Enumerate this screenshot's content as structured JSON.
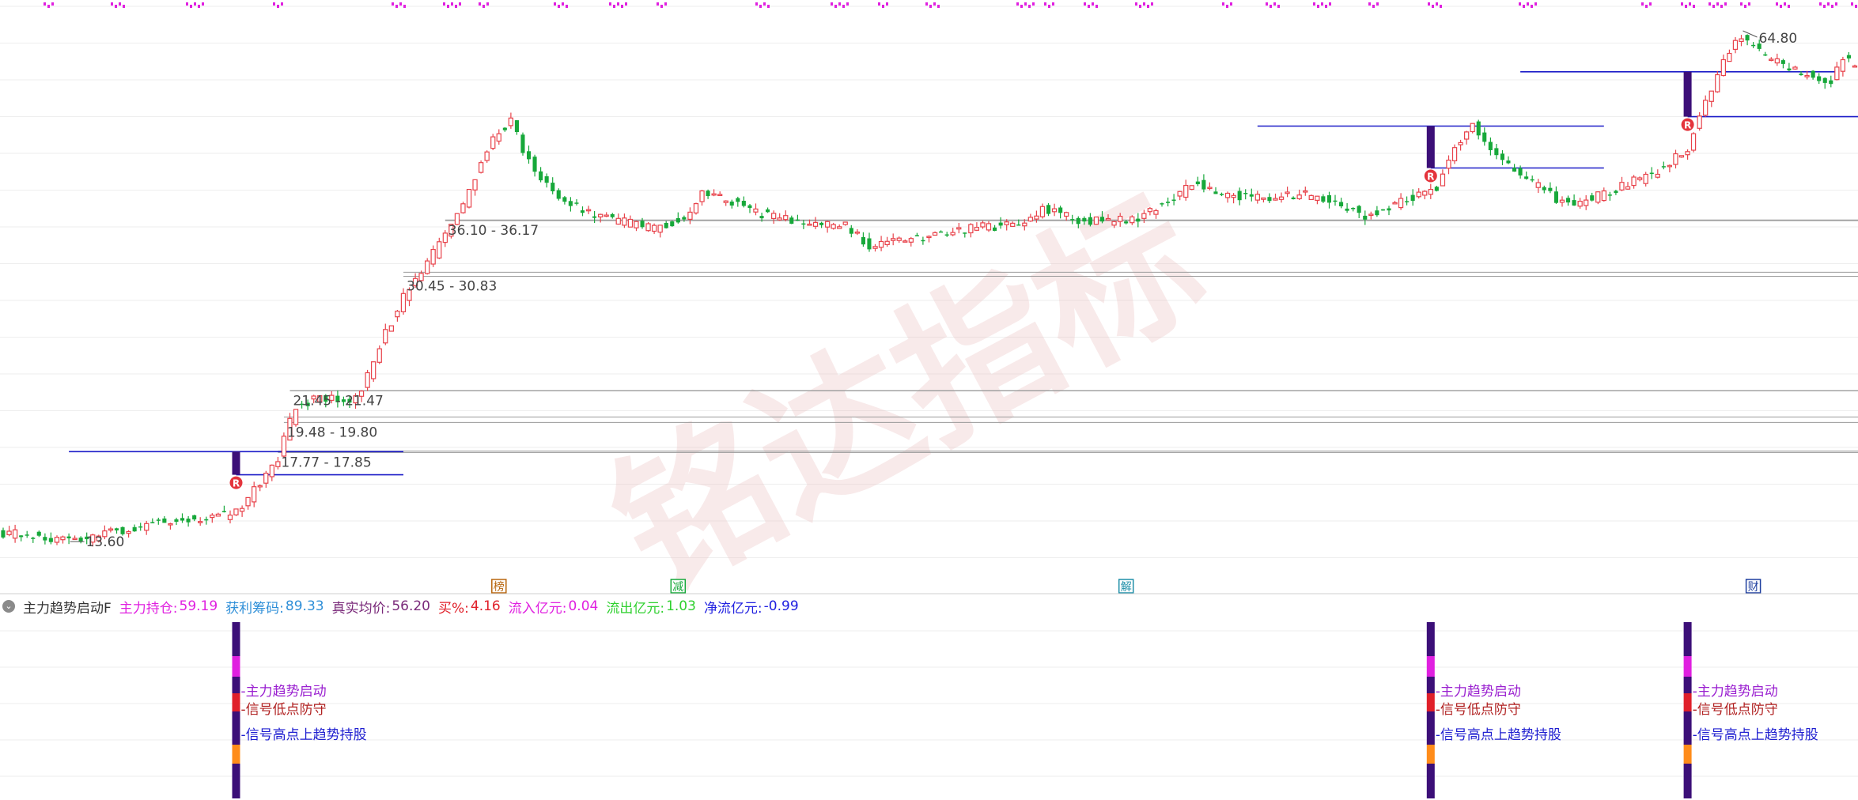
{
  "indicator_bar": {
    "name": "主力趋势启动F",
    "fields": [
      {
        "label": "主力持仓:",
        "value": "59.19",
        "color": "#e020e0"
      },
      {
        "label": "获利筹码:",
        "value": "89.33",
        "color": "#2f8fd8"
      },
      {
        "label": "真实均价:",
        "value": "56.20",
        "color": "#7a2a7a"
      },
      {
        "label": "买%:",
        "value": "4.16",
        "color": "#e0202a"
      },
      {
        "label": "流入亿元:",
        "value": "0.04",
        "color": "#e020e0"
      },
      {
        "label": "流出亿元:",
        "value": "1.03",
        "color": "#2fd02f"
      },
      {
        "label": "净流亿元:",
        "value": "-0.99",
        "color": "#2020e0"
      }
    ]
  },
  "watermark": "铭达指标",
  "colors": {
    "up": "#e8434b",
    "down": "#17a83a",
    "signal_bar": "#3c0f78",
    "support_line": "#1c1cc8",
    "zone_line": "#9a9a9a",
    "label_text": "#444444",
    "magenta": "#e020e0",
    "red": "#e0202a",
    "orange": "#ff8c1a",
    "blue_label": "#1f1fd0",
    "red_label": "#b02020",
    "purple_label": "#9a20d0"
  },
  "chart_data": {
    "type": "candlestick",
    "y_axis": {
      "scale": "log",
      "ylim": [
        12.5,
        68.5
      ]
    },
    "x_axis": {
      "bar_count": 311
    },
    "price_labels": [
      {
        "text": "64.80",
        "price": 64.8,
        "bar": 291,
        "kind": "high"
      },
      {
        "text": "13.60",
        "price": 13.6,
        "bar": 12,
        "kind": "low"
      }
    ],
    "price_zones": [
      {
        "text": "36.10 - 36.17",
        "low": 36.1,
        "high": 36.17,
        "start_bar": 74
      },
      {
        "text": "30.45 - 30.83",
        "low": 30.45,
        "high": 30.83,
        "start_bar": 67
      },
      {
        "text": "21.45 - 21.47",
        "low": 21.45,
        "high": 21.47,
        "start_bar": 48
      },
      {
        "text": "19.48 - 19.80",
        "low": 19.48,
        "high": 19.8,
        "start_bar": 47
      },
      {
        "text": "17.77 - 17.85",
        "low": 17.77,
        "high": 17.85,
        "start_bar": 46
      }
    ],
    "signal_segments": [
      {
        "start_bar": 11,
        "end_bar": 67,
        "price": 17.82
      },
      {
        "start_bar": 39,
        "end_bar": 67,
        "price": 16.6
      },
      {
        "start_bar": 210,
        "end_bar": 268,
        "price": 48.2
      },
      {
        "start_bar": 239,
        "end_bar": 268,
        "price": 42.4
      },
      {
        "start_bar": 254,
        "end_bar": 307,
        "price": 56.9
      },
      {
        "start_bar": 282,
        "end_bar": 311,
        "price": 49.6
      }
    ],
    "signal_bars": [
      {
        "bar": 39,
        "top": 17.82,
        "bottom": 16.6,
        "marker": "R"
      },
      {
        "bar": 239,
        "top": 48.2,
        "bottom": 42.4,
        "marker": "R"
      },
      {
        "bar": 282,
        "top": 56.9,
        "bottom": 49.6,
        "marker": "R"
      }
    ],
    "event_markers": [
      {
        "text": "榜",
        "bar": 83,
        "color": "#b8660e"
      },
      {
        "text": "减",
        "bar": 113,
        "color": "#17a83a"
      },
      {
        "text": "解",
        "bar": 188,
        "color": "#1f8fa8"
      },
      {
        "text": "财",
        "bar": 293,
        "color": "#1f3f9f"
      }
    ],
    "lower_panel": {
      "signal_bars": [
        39,
        239,
        282
      ],
      "labels": [
        "-主力趋势启动",
        "-信号低点防守",
        "-信号高点上趋势持股"
      ]
    }
  }
}
